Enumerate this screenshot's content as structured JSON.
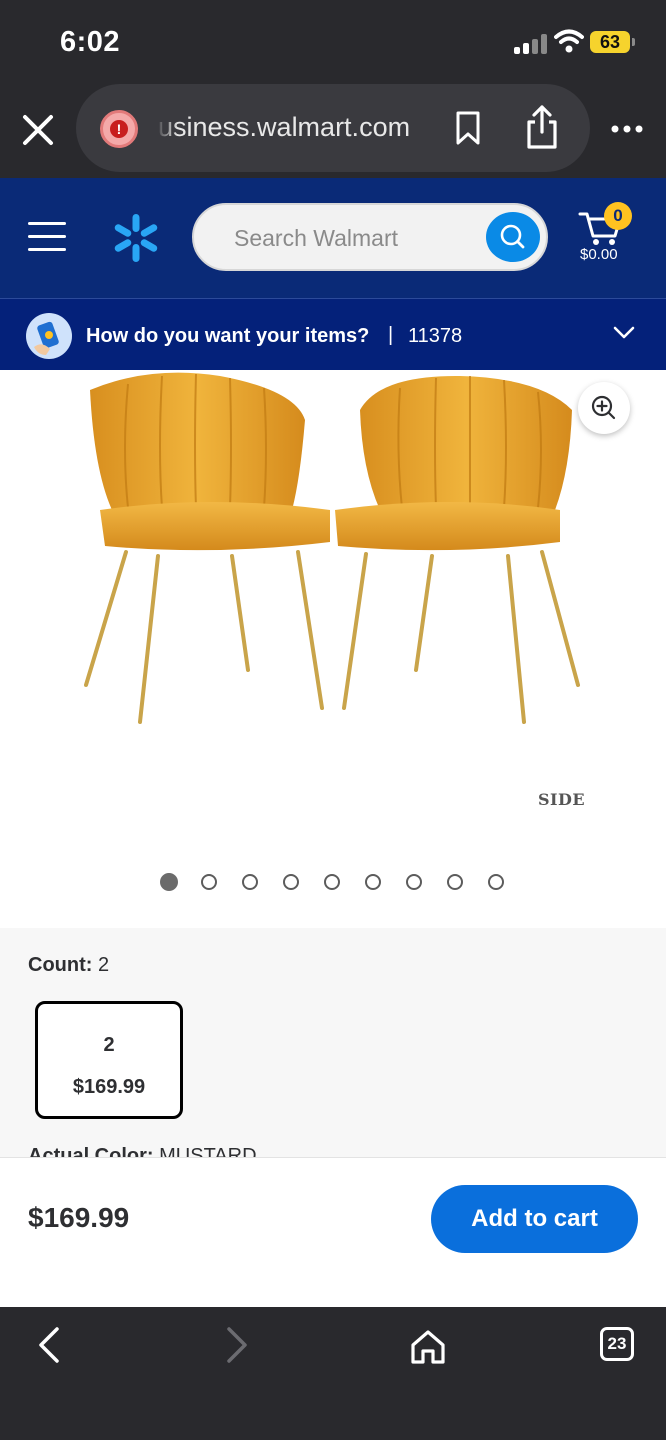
{
  "status_bar": {
    "time": "6:02",
    "battery": "63"
  },
  "browser": {
    "url": "usiness.walmart.com"
  },
  "header": {
    "search_placeholder": "Search Walmart",
    "cart_count": "0",
    "cart_total": "$0.00"
  },
  "delivery": {
    "prompt": "How do you want your items?",
    "separator": "|",
    "zip": "11378"
  },
  "gallery": {
    "side_label": "SIDE",
    "dot_count": 9,
    "active_dot": 0
  },
  "options": {
    "count_label": "Count:",
    "count_value": "2",
    "variant": {
      "count": "2",
      "price": "$169.99"
    },
    "color_label": "Actual Color:",
    "color_value": "MUSTARD"
  },
  "buy": {
    "price": "$169.99",
    "add_to_cart": "Add to cart"
  },
  "browser_nav": {
    "tab_count": "23"
  },
  "colors": {
    "walmart_blue": "#0a2a77",
    "spark_yellow": "#ffc220",
    "action_blue": "#0a6fdc",
    "chair_mustard": "#e6a22d"
  }
}
